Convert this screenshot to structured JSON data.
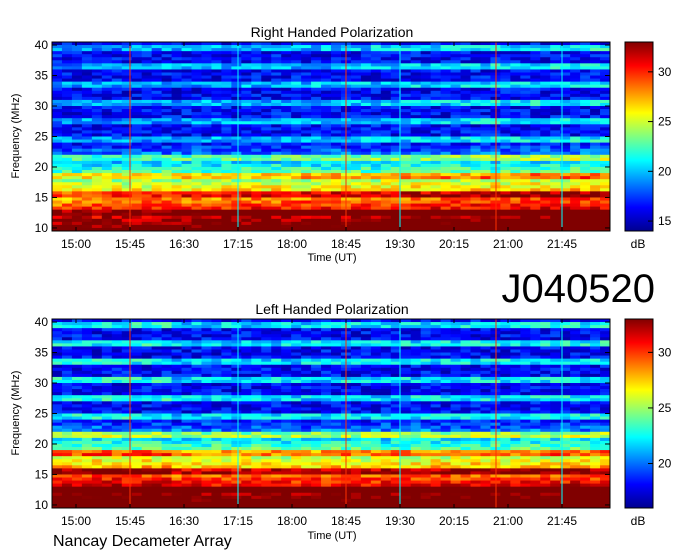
{
  "identifier": "J040520",
  "footer": "Nancay Decameter Array",
  "colors": {
    "scale": [
      "#00008f",
      "#0000ff",
      "#0080ff",
      "#00ffff",
      "#80ff80",
      "#ffff00",
      "#ff8000",
      "#ff0000",
      "#800000"
    ]
  },
  "chart_data": [
    {
      "type": "heatmap",
      "title": "Right Handed Polarization",
      "xlabel": "Time (UT)",
      "ylabel": "Frequency (MHz)",
      "colorbar_label": "dB",
      "x_ticks": [
        "15:00",
        "15:45",
        "16:30",
        "17:15",
        "18:00",
        "18:45",
        "19:30",
        "20:15",
        "21:00",
        "21:45"
      ],
      "x_range": [
        "14:40",
        "22:25"
      ],
      "y_ticks": [
        10,
        15,
        20,
        25,
        30,
        35,
        40
      ],
      "ylim": [
        9.5,
        40.5
      ],
      "colorbar_ticks": [
        15,
        20,
        25,
        30
      ],
      "colorbar_range": [
        14,
        33
      ],
      "vertical_markers": [
        "15:45",
        "17:15",
        "18:45",
        "19:30",
        "20:50",
        "21:45"
      ]
    },
    {
      "type": "heatmap",
      "title": "Left Handed Polarization",
      "xlabel": "Time (UT)",
      "ylabel": "Frequency (MHz)",
      "colorbar_label": "dB",
      "x_ticks": [
        "15:00",
        "15:45",
        "16:30",
        "17:15",
        "18:00",
        "18:45",
        "19:30",
        "20:15",
        "21:00",
        "21:45"
      ],
      "x_range": [
        "14:40",
        "22:25"
      ],
      "y_ticks": [
        10,
        15,
        20,
        25,
        30,
        35,
        40
      ],
      "ylim": [
        9.5,
        40.5
      ],
      "colorbar_ticks": [
        20,
        25,
        30
      ],
      "colorbar_range": [
        16,
        33
      ],
      "vertical_markers": [
        "15:45",
        "17:15",
        "18:45",
        "19:30",
        "20:50",
        "21:45"
      ]
    }
  ]
}
